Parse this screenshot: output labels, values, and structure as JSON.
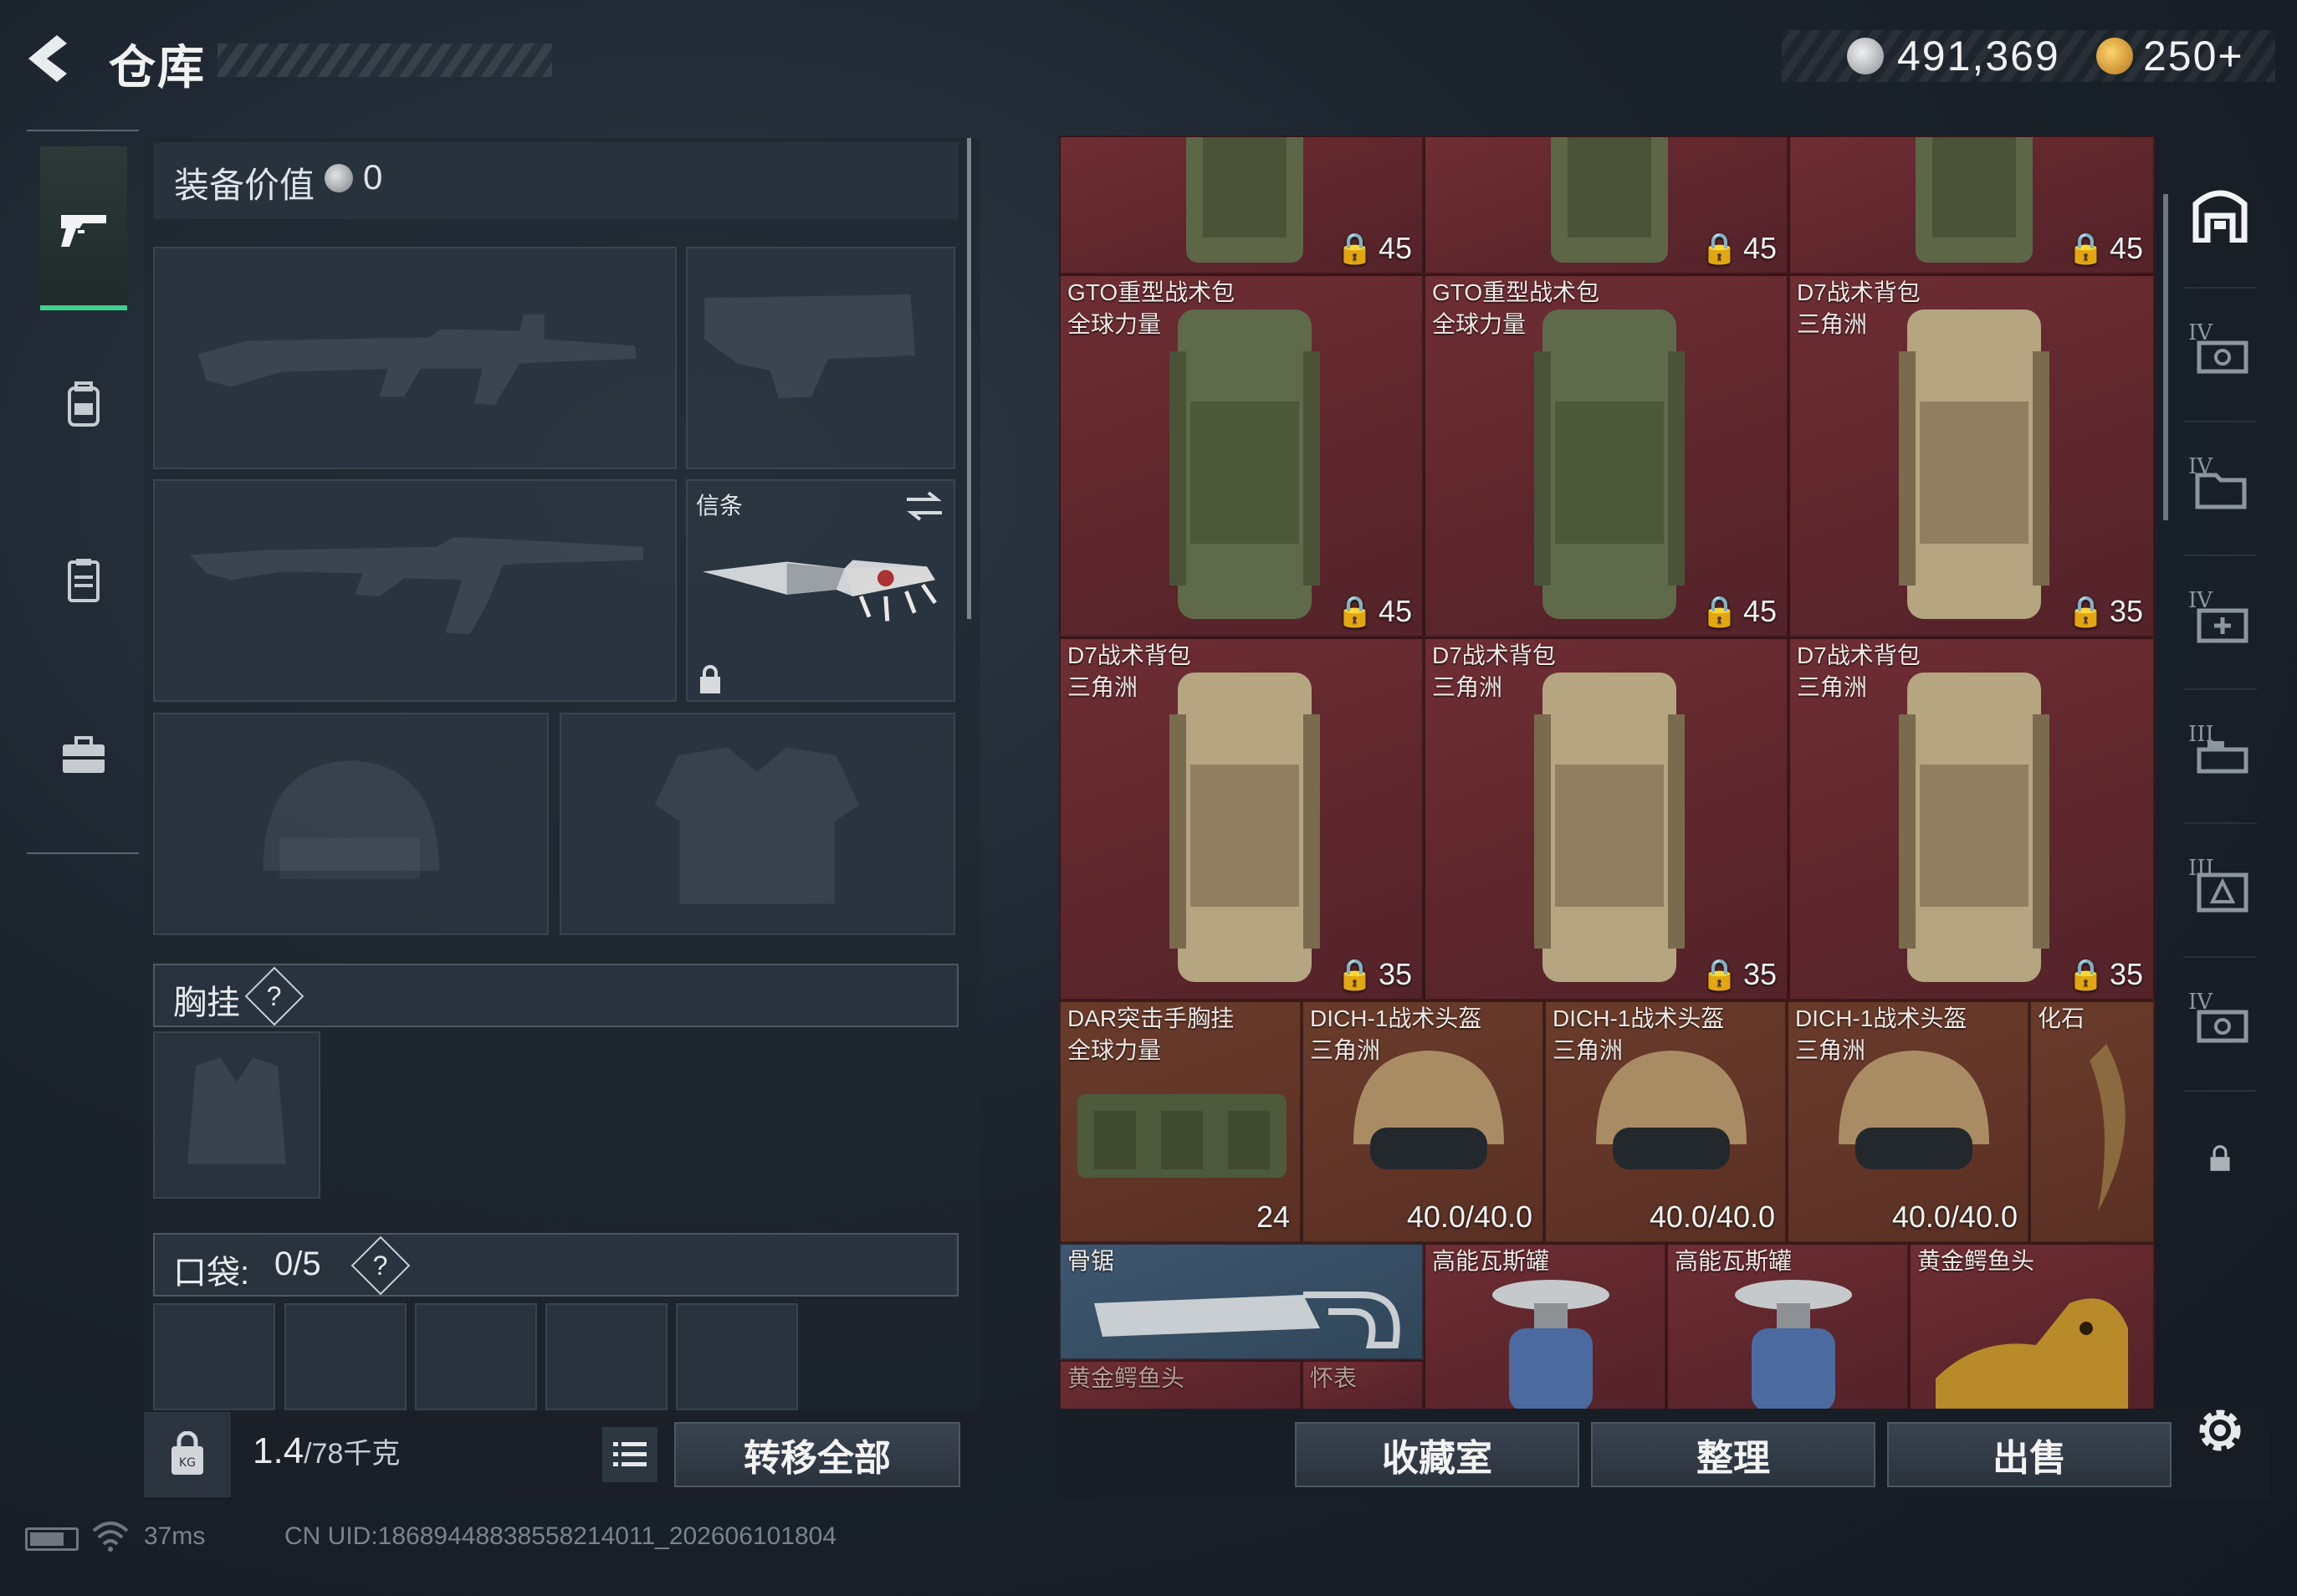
{
  "header": {
    "title": "仓库",
    "silver_amount": "491,369",
    "gold_amount": "250+"
  },
  "left_nav": {
    "items": [
      {
        "icon": "pistol-icon",
        "active": true
      },
      {
        "icon": "backpack-icon",
        "active": false
      },
      {
        "icon": "clipboard-icon",
        "active": false
      },
      {
        "icon": "briefcase-icon",
        "active": false
      }
    ]
  },
  "equipment": {
    "value_label": "装备价值",
    "value": "0",
    "melee_label": "信条",
    "chest_rig_label": "胸挂",
    "help_mark": "?",
    "pocket_label": "口袋:",
    "pocket_count": "0/5"
  },
  "weight": {
    "current": "1.4",
    "max": "/78千克"
  },
  "buttons": {
    "transfer_all": "转移全部",
    "collection": "收藏室",
    "sort": "整理",
    "sell": "出售"
  },
  "storage": {
    "top_row": [
      {
        "count": "45"
      },
      {
        "count": "45"
      },
      {
        "count": "45"
      }
    ],
    "row2": [
      {
        "name": "GTO重型战术包",
        "sub": "全球力量",
        "count": "45"
      },
      {
        "name": "GTO重型战术包",
        "sub": "全球力量",
        "count": "45"
      },
      {
        "name": "D7战术背包",
        "sub": "三角洲",
        "count": "35"
      }
    ],
    "row3": [
      {
        "name": "D7战术背包",
        "sub": "三角洲",
        "count": "35"
      },
      {
        "name": "D7战术背包",
        "sub": "三角洲",
        "count": "35"
      },
      {
        "name": "D7战术背包",
        "sub": "三角洲",
        "count": "35"
      }
    ],
    "row4": [
      {
        "name": "DAR突击手胸挂",
        "sub": "全球力量",
        "count": "24"
      },
      {
        "name": "DICH-1战术头盔",
        "sub": "三角洲",
        "count": "40.0/40.0"
      },
      {
        "name": "DICH-1战术头盔",
        "sub": "三角洲",
        "count": "40.0/40.0"
      },
      {
        "name": "DICH-1战术头盔",
        "sub": "三角洲",
        "count": "40.0/40.0"
      },
      {
        "name": "化石",
        "sub": "",
        "count": ""
      }
    ],
    "row5": [
      {
        "name": "骨锯"
      },
      {
        "name": "高能瓦斯罐"
      },
      {
        "name": "高能瓦斯罐"
      },
      {
        "name": "黄金鳄鱼头"
      }
    ],
    "row6": [
      {
        "name": "黄金鳄鱼头"
      },
      {
        "name": "怀表"
      }
    ]
  },
  "right_nav": {
    "tiers": [
      "IV",
      "IV",
      "IV",
      "III",
      "III",
      "IV"
    ]
  },
  "status": {
    "ping": "37ms",
    "uid": "CN UID:18689448838558214011_202606101804"
  },
  "colors": {
    "accent_green": "#3fcf8e",
    "cell_red": "#6e2e34",
    "cell_brown": "#6a3b2b",
    "cell_blue": "#3e5770"
  }
}
